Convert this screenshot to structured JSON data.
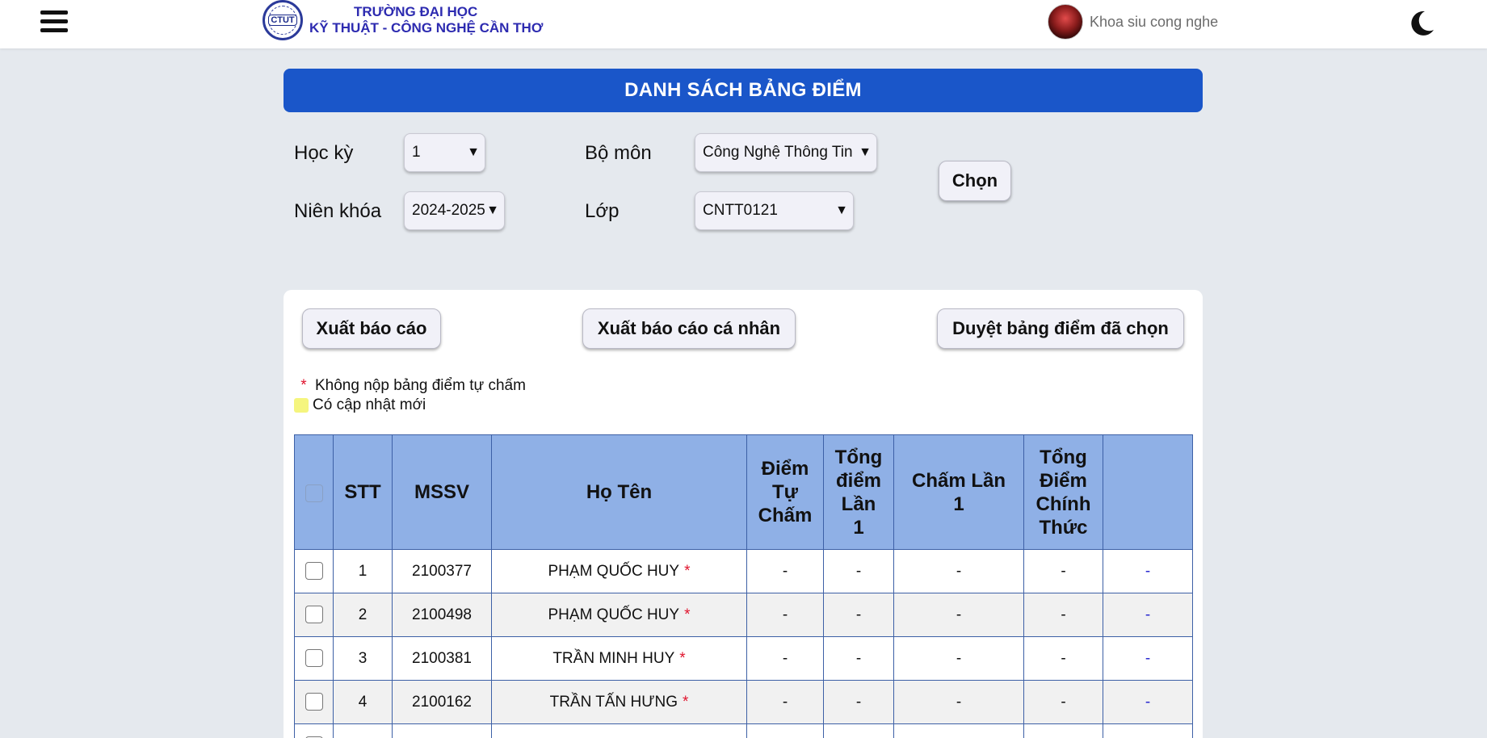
{
  "header": {
    "logo": {
      "seal_text": "CTUT",
      "line1": "TRƯỜNG ĐẠI HỌC",
      "line2": "KỸ THUẬT - CÔNG NGHỆ CẦN THƠ"
    },
    "user_name": "Khoa siu cong nghe",
    "icons": [
      "menu-icon",
      "avatar",
      "moon-icon"
    ]
  },
  "page_title": "DANH SÁCH BẢNG ĐIỂM",
  "filters": {
    "hoc_ky": {
      "label": "Học kỳ",
      "value": "1"
    },
    "nien_khoa": {
      "label": "Niên khóa",
      "value": "2024-2025"
    },
    "bo_mon": {
      "label": "Bộ môn",
      "value": "Công Nghệ Thông Tin"
    },
    "lop": {
      "label": "Lớp",
      "value": "CNTT0121"
    },
    "select_button": "Chọn",
    "arrow_glyph": "▼"
  },
  "actions": {
    "export_report": "Xuất báo cáo",
    "export_personal": "Xuất báo cáo cá nhân",
    "approve_selected": "Duyệt bảng điểm đã chọn"
  },
  "legend": {
    "not_submitted_mark": "*",
    "not_submitted": "Không nộp bảng điểm tự chấm",
    "updated": "Có cập nhật mới"
  },
  "table": {
    "headers": {
      "stt": "STT",
      "mssv": "MSSV",
      "ho_ten": "Họ Tên",
      "diem_tu_cham": [
        "Điểm",
        "Tự",
        "Chấm"
      ],
      "tong_diem_lan1": [
        "Tổng",
        "điểm",
        "Lần",
        "1"
      ],
      "cham_lan1": [
        "Chấm Lần",
        "1"
      ],
      "tong_diem_chinh_thuc": [
        "Tổng",
        "Điểm",
        "Chính",
        "Thức"
      ],
      "action": ""
    },
    "rows": [
      {
        "stt": "1",
        "mssv": "2100377",
        "name": "PHẠM QUỐC HUY",
        "mark": "*",
        "self": "-",
        "total1": "-",
        "grade1": "-",
        "official": "-",
        "action": "-"
      },
      {
        "stt": "2",
        "mssv": "2100498",
        "name": "PHẠM QUỐC HUY",
        "mark": "*",
        "self": "-",
        "total1": "-",
        "grade1": "-",
        "official": "-",
        "action": "-"
      },
      {
        "stt": "3",
        "mssv": "2100381",
        "name": "TRẦN MINH HUY",
        "mark": "*",
        "self": "-",
        "total1": "-",
        "grade1": "-",
        "official": "-",
        "action": "-"
      },
      {
        "stt": "4",
        "mssv": "2100162",
        "name": "TRẦN TẤN HƯNG",
        "mark": "*",
        "self": "-",
        "total1": "-",
        "grade1": "-",
        "official": "-",
        "action": "-"
      }
    ]
  },
  "colors": {
    "banner": "#1a56c9",
    "table_header": "#8fb0e6",
    "table_border": "#3d60a6",
    "required_mark": "#e0142d",
    "updated_swatch": "#f5f57e",
    "link": "#2a2ad0"
  }
}
